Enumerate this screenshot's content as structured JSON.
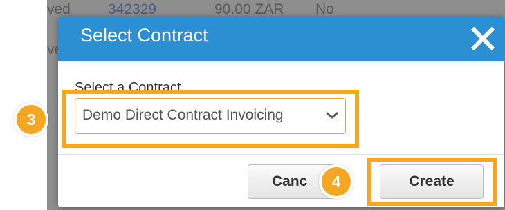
{
  "background": {
    "row1": {
      "status": "ved",
      "number": "342329",
      "amount": "90.00 ZAR",
      "flag": "No"
    },
    "row2": {
      "status": "ve"
    }
  },
  "dialog": {
    "title": "Select Contract",
    "close_icon": "close-icon",
    "field_label": "Select a Contract",
    "selected_contract": "Demo Direct Contract Invoicing",
    "cancel_label": "Canc",
    "create_label": "Create"
  },
  "annotations": {
    "step3": "3",
    "step4": "4",
    "highlight_color": "#f5a623"
  },
  "colors": {
    "header": "#2b8fd1",
    "select_border": "#f39b36",
    "overlay": "#8e8e8e"
  }
}
